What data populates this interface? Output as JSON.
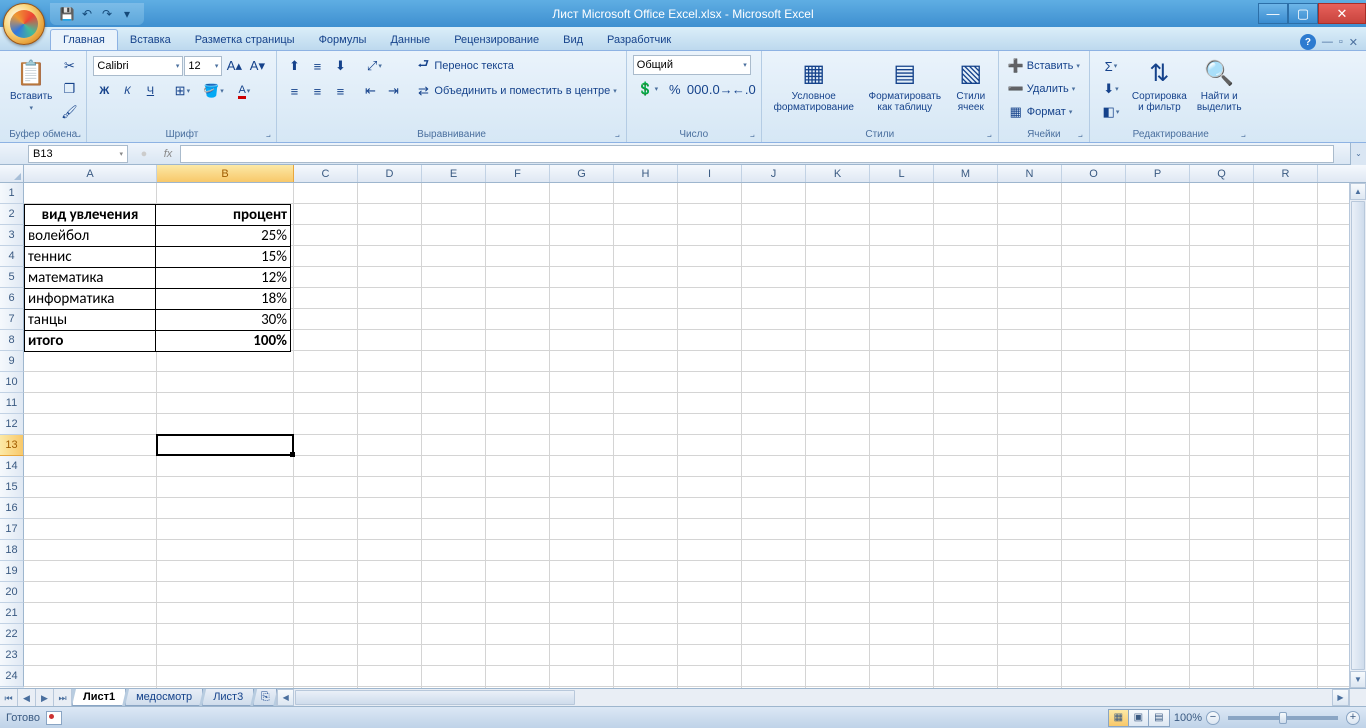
{
  "title": "Лист Microsoft Office Excel.xlsx - Microsoft Excel",
  "qat": {
    "save": "💾",
    "undo": "↶",
    "redo": "↷",
    "more": "▾"
  },
  "tabs": [
    "Главная",
    "Вставка",
    "Разметка страницы",
    "Формулы",
    "Данные",
    "Рецензирование",
    "Вид",
    "Разработчик"
  ],
  "activeTab": 0,
  "ribbon": {
    "clipboard": {
      "label": "Буфер обмена",
      "paste": "Вставить",
      "paste_icon": "📋"
    },
    "font": {
      "label": "Шрифт",
      "name": "Calibri",
      "size": "12"
    },
    "alignment": {
      "label": "Выравнивание",
      "wrap": "Перенос текста",
      "merge": "Объединить и поместить в центре"
    },
    "number": {
      "label": "Число",
      "format": "Общий"
    },
    "styles": {
      "label": "Стили",
      "cond": "Условное\nформатирование",
      "table": "Форматировать\nкак таблицу",
      "cell": "Стили\nячеек"
    },
    "cells": {
      "label": "Ячейки",
      "insert": "Вставить",
      "delete": "Удалить",
      "format": "Формат"
    },
    "editing": {
      "label": "Редактирование",
      "sort": "Сортировка\nи фильтр",
      "find": "Найти и\nвыделить"
    }
  },
  "nameBox": "B13",
  "fx": "fx",
  "columns": [
    "A",
    "B",
    "C",
    "D",
    "E",
    "F",
    "G",
    "H",
    "I",
    "J",
    "K",
    "L",
    "M",
    "N",
    "O",
    "P",
    "Q",
    "R"
  ],
  "colWidths": {
    "A": 133,
    "B": 137,
    "default": 64
  },
  "selectedCol": "B",
  "rows": 24,
  "selectedRow": 13,
  "tableData": {
    "header": {
      "a": "вид увлечения",
      "b": "процент"
    },
    "rows": [
      {
        "a": "волейбол",
        "b": "25%"
      },
      {
        "a": "теннис",
        "b": "15%"
      },
      {
        "a": "математика",
        "b": "12%"
      },
      {
        "a": "информатика",
        "b": "18%"
      },
      {
        "a": "танцы",
        "b": "30%"
      }
    ],
    "total": {
      "a": "итого",
      "b": "100%"
    }
  },
  "sheets": [
    "Лист1",
    "медосмотр",
    "Лист3"
  ],
  "activeSheet": 0,
  "status": "Готово",
  "zoom": "100%"
}
